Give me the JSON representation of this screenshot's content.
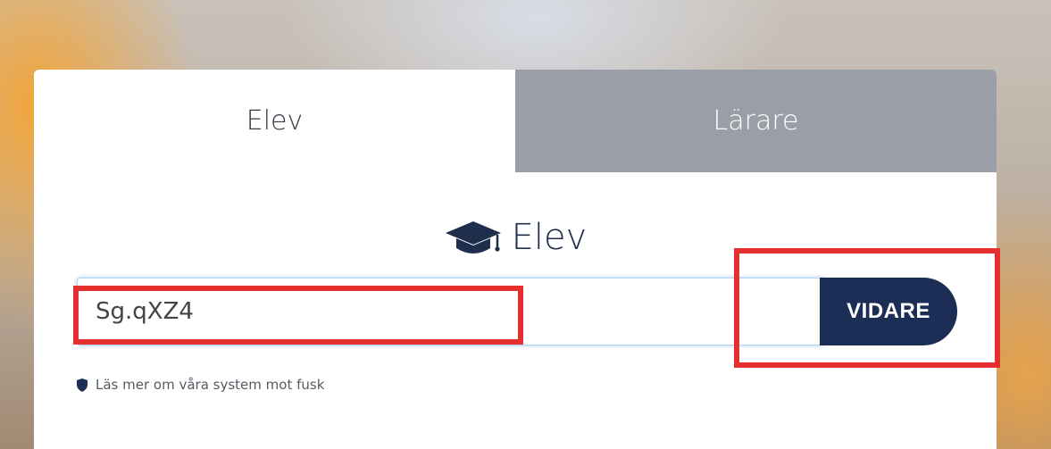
{
  "tabs": [
    {
      "label": "Elev",
      "active": true
    },
    {
      "label": "Lärare",
      "active": false
    }
  ],
  "heading": {
    "label": "Elev",
    "icon": "graduation-cap-icon"
  },
  "code_input": {
    "value": "Sg.qXZ4"
  },
  "submit": {
    "label": "VIDARE"
  },
  "note": {
    "label": "Läs mer om våra system mot fusk",
    "icon": "shield-icon"
  },
  "colors": {
    "brand_navy": "#1c2e55",
    "inactive_tab": "#9a9ea6",
    "annotation_red": "#e6302f"
  }
}
